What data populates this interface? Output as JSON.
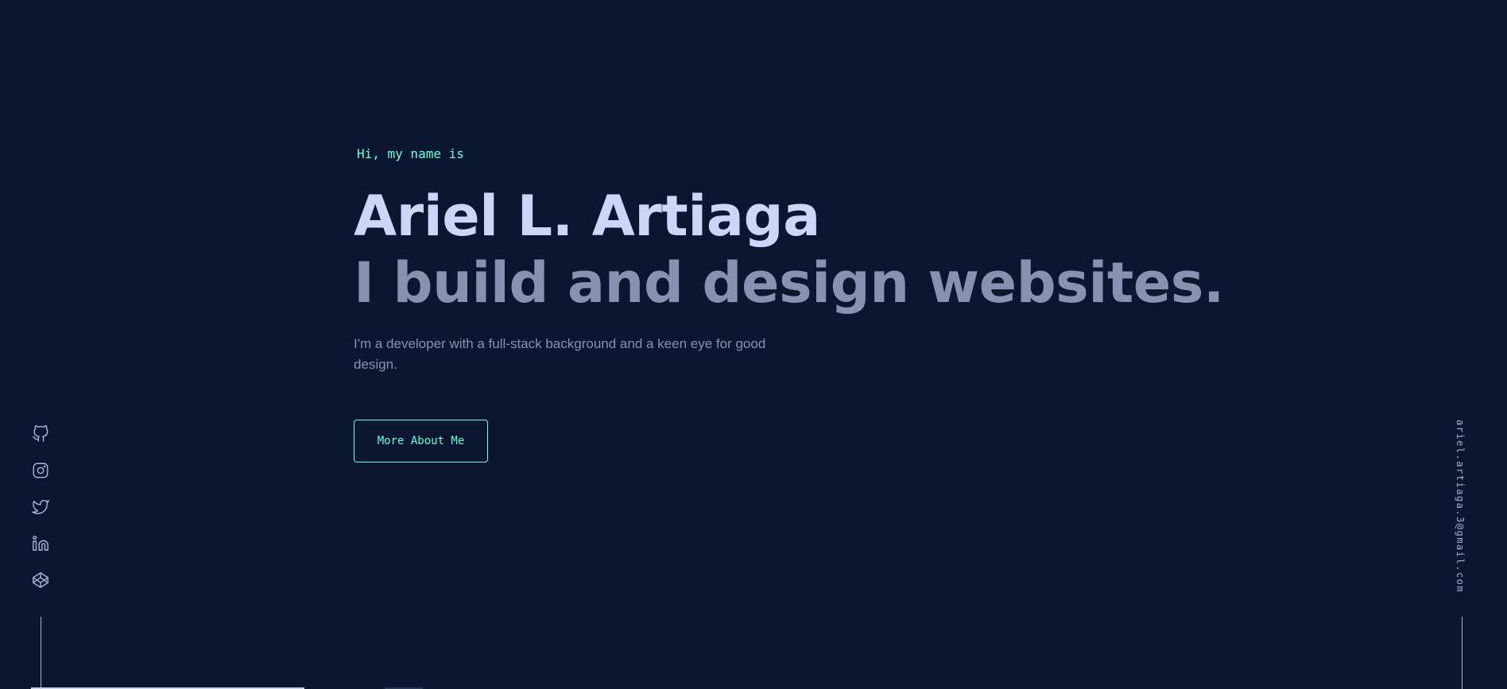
{
  "hero": {
    "greeting": "Hi, my name is",
    "name": "Ariel L. Artiaga",
    "tagline": "I build and design websites.",
    "description": "I'm a developer with a full-stack background and a keen eye for good design.",
    "cta_label": "More About Me"
  },
  "social": {
    "items": [
      {
        "icon": "github-icon"
      },
      {
        "icon": "instagram-icon"
      },
      {
        "icon": "twitter-icon"
      },
      {
        "icon": "linkedin-icon"
      },
      {
        "icon": "codepen-icon"
      }
    ]
  },
  "email": {
    "address": "ariel.artiaga.3@gmail.com"
  },
  "colors": {
    "background": "#0b1730",
    "accent": "#64ffda",
    "heading": "#ccd6f6",
    "muted": "#8892b0"
  }
}
